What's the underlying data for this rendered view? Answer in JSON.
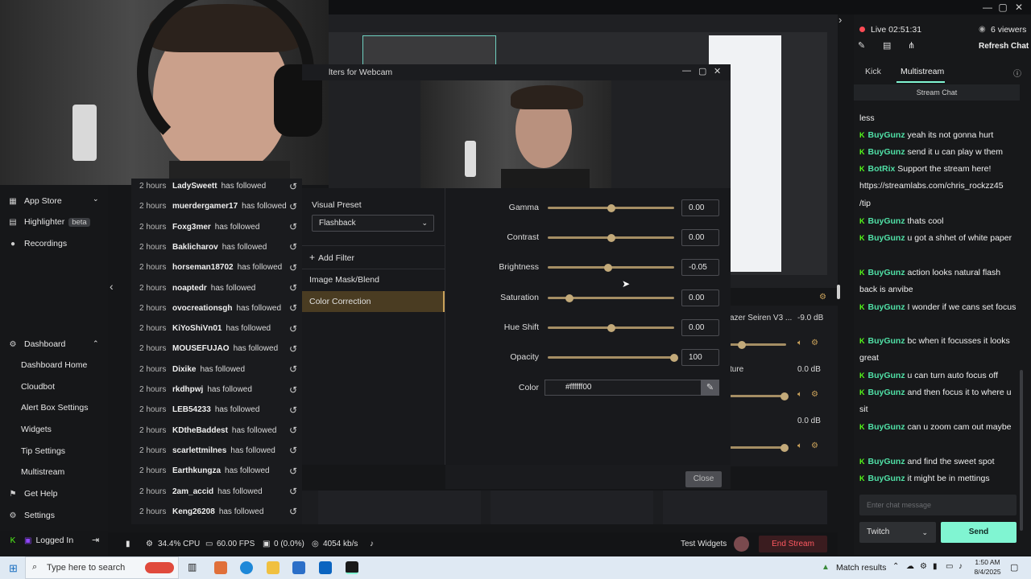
{
  "window": {
    "minimize": "—",
    "maximize": "▢",
    "close": "✕"
  },
  "sidebar": {
    "collapse_arrow": "‹",
    "items_top": [
      {
        "label": "App Store",
        "icon": "store-icon",
        "chevron": "⌄"
      },
      {
        "label": "Highlighter",
        "badge": "beta",
        "icon": "highlighter-icon"
      },
      {
        "label": "Recordings",
        "icon": "record-icon"
      }
    ],
    "dashboard": {
      "label": "Dashboard",
      "chevron": "⌃"
    },
    "dashboard_items": [
      "Dashboard Home",
      "Cloudbot",
      "Alert Box Settings",
      "Widgets",
      "Tip Settings",
      "Multistream"
    ],
    "items_bottom": [
      {
        "label": "Get Help",
        "icon": "help-icon"
      },
      {
        "label": "Settings",
        "icon": "gear-icon"
      },
      {
        "label": "Logged In",
        "icon": "logout-icon"
      }
    ]
  },
  "events": {
    "action": "has followed",
    "rows": [
      {
        "time": "2 hours",
        "name": "LadySweett"
      },
      {
        "time": "2 hours",
        "name": "muerdergamer17"
      },
      {
        "time": "2 hours",
        "name": "Foxg3mer"
      },
      {
        "time": "2 hours",
        "name": "Baklicharov"
      },
      {
        "time": "2 hours",
        "name": "horseman18702"
      },
      {
        "time": "2 hours",
        "name": "noaptedr"
      },
      {
        "time": "2 hours",
        "name": "ovocreationsgh"
      },
      {
        "time": "2 hours",
        "name": "KiYoShiVn01"
      },
      {
        "time": "2 hours",
        "name": "MOUSEFUJAO"
      },
      {
        "time": "2 hours",
        "name": "Dixike"
      },
      {
        "time": "2 hours",
        "name": "rkdhpwj"
      },
      {
        "time": "2 hours",
        "name": "LEB54233"
      },
      {
        "time": "2 hours",
        "name": "KDtheBaddest"
      },
      {
        "time": "2 hours",
        "name": "scarlettmilnes"
      },
      {
        "time": "2 hours",
        "name": "Earthkungza"
      },
      {
        "time": "2 hours",
        "name": "2am_accid"
      },
      {
        "time": "2 hours",
        "name": "Keng26208"
      }
    ]
  },
  "filters_dialog": {
    "title": "lters for Webcam",
    "visual_preset_label": "Visual Preset",
    "visual_preset_value": "Flashback",
    "add_filter": "Add Filter",
    "filters": [
      "Image Mask/Blend",
      "Color Correction"
    ],
    "selected_filter": "Color Correction",
    "params": [
      {
        "label": "Gamma",
        "value": "0.00",
        "level": 0.5
      },
      {
        "label": "Contrast",
        "value": "0.00",
        "level": 0.5
      },
      {
        "label": "Brightness",
        "value": "-0.05",
        "level": 0.475
      },
      {
        "label": "Saturation",
        "value": "0.00",
        "level": 0.17
      },
      {
        "label": "Hue Shift",
        "value": "0.00",
        "level": 0.5
      },
      {
        "label": "Opacity",
        "value": "100",
        "level": 1.0
      }
    ],
    "color_label": "Color",
    "color_value": "#ffffff00",
    "close": "Close"
  },
  "mixer": {
    "tracks": [
      {
        "name": "azer Seiren V3 ...",
        "db": "-9.0 dB",
        "level": 0.22
      },
      {
        "name": "ture",
        "db": "0.0 dB",
        "level": 0.97
      },
      {
        "name": "",
        "db": "0.0 dB",
        "level": 0.97
      }
    ]
  },
  "statusbar": {
    "cpu": "34.4% CPU",
    "fps": "60.00 FPS",
    "dropped": "0 (0.0%)",
    "bitrate": "4054 kb/s",
    "test_widgets": "Test Widgets",
    "end_stream": "End Stream"
  },
  "right_panel": {
    "live": "Live 02:51:31",
    "viewers": "6 viewers",
    "refresh_chat": "Refresh Chat",
    "tabs": [
      "Kick",
      "Multistream"
    ],
    "active_tab": "Multistream",
    "sub_header": "Stream Chat",
    "chat": [
      {
        "user": "",
        "text": "less"
      },
      {
        "user": "BuyGunz",
        "text": "yeah its not gonna hurt"
      },
      {
        "user": "BuyGunz",
        "text": "send it u can play w them"
      },
      {
        "user": "BotRix",
        "text": "Support the stream here! https://streamlabs.com/chris_rockzz45 /tip"
      },
      {
        "user": "BuyGunz",
        "text": "thats cool"
      },
      {
        "user": "BuyGunz",
        "text": "u got a shhet of white paper"
      },
      {
        "user": "BuyGunz",
        "text": "action looks natural flash back is anvibe"
      },
      {
        "user": "BuyGunz",
        "text": "I wonder if we cans set focus"
      },
      {
        "user": "BuyGunz",
        "text": "bc when it focusses it looks great"
      },
      {
        "user": "BuyGunz",
        "text": "u can turn auto focus off"
      },
      {
        "user": "BuyGunz",
        "text": "and then focus it to where u sit"
      },
      {
        "user": "BuyGunz",
        "text": "can u zoom cam out maybe"
      },
      {
        "user": "BuyGunz",
        "text": "and find the sweet spot"
      },
      {
        "user": "BuyGunz",
        "text": "it might be in mettings"
      }
    ],
    "chat_placeholder": "Enter chat message",
    "platform": "Twitch",
    "send": "Send"
  },
  "taskbar": {
    "search_placeholder": "Type here to search",
    "match_results": "Match results",
    "time": "1:50 AM",
    "date": "8/4/2025"
  }
}
